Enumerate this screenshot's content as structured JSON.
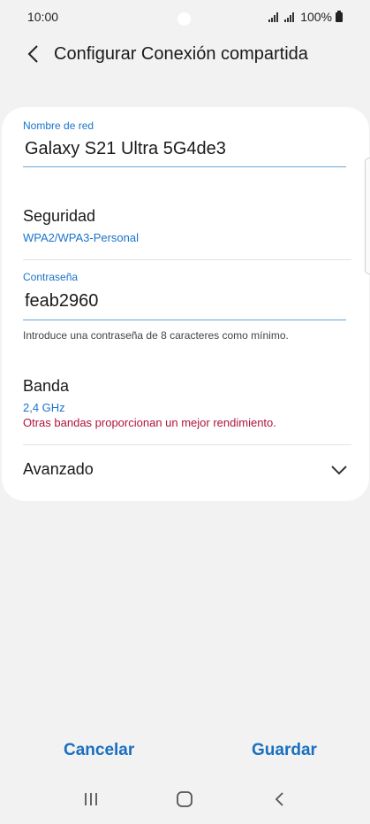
{
  "status_bar": {
    "time": "10:00",
    "battery_text": "100%"
  },
  "header": {
    "title": "Configurar Conexión compartida",
    "back_icon": "chevron-left-icon"
  },
  "form": {
    "network_name": {
      "label": "Nombre de red",
      "value": "Galaxy S21 Ultra 5G4de3"
    },
    "security": {
      "title": "Seguridad",
      "value": "WPA2/WPA3-Personal"
    },
    "password": {
      "label": "Contraseña",
      "value": "feab2960",
      "helper": "Introduce una contraseña de 8 caracteres como mínimo."
    },
    "band": {
      "title": "Banda",
      "value": "2,4 GHz",
      "warning": "Otras bandas proporcionan un mejor rendimiento."
    },
    "advanced": {
      "title": "Avanzado",
      "icon": "chevron-down-icon"
    }
  },
  "actions": {
    "cancel_label": "Cancelar",
    "save_label": "Guardar"
  },
  "colors": {
    "accent": "#1a73c9",
    "warning": "#b0143c",
    "background": "#f2f2f2",
    "card": "#ffffff"
  },
  "nav_bar": {
    "recents_icon": "recents-icon",
    "home_icon": "home-icon",
    "back_icon": "back-icon"
  }
}
